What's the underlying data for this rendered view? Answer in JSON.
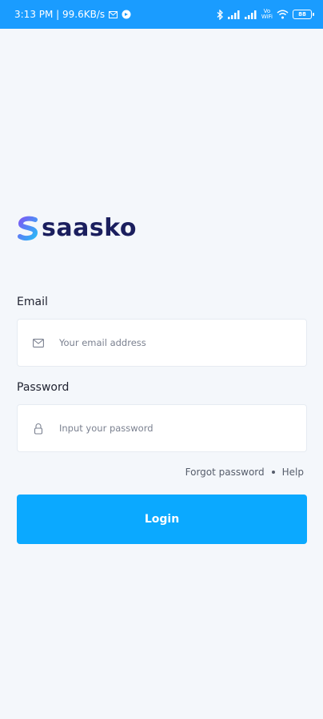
{
  "status_bar": {
    "time_speed": "3:13 PM | 99.6KB/s",
    "volte_top": "Vo",
    "volte_bottom": "WiFi",
    "battery": "88"
  },
  "logo": {
    "text": "saasko"
  },
  "form": {
    "email_label": "Email",
    "email_placeholder": "Your email address",
    "password_label": "Password",
    "password_placeholder": "Input your password"
  },
  "links": {
    "forgot_password": "Forgot password",
    "help": "Help"
  },
  "login_button": "Login",
  "colors": {
    "status_bar": "#1a9cff",
    "primary_button": "#0ba9ff",
    "logo_text": "#1b1f5e",
    "background": "#f4f7fb"
  }
}
